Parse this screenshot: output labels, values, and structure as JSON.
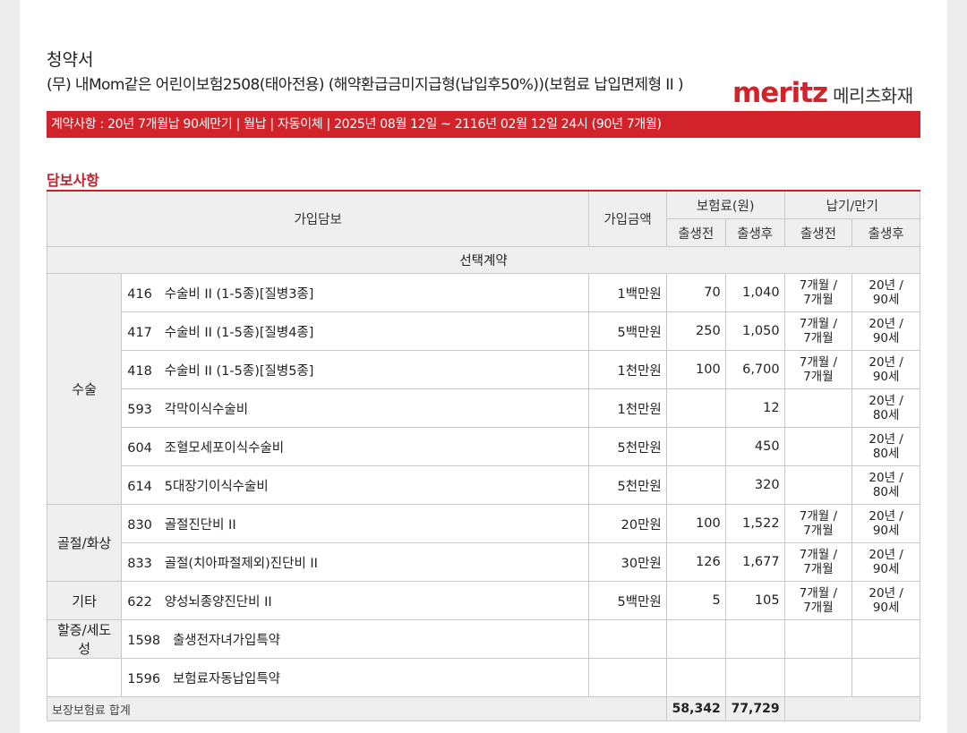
{
  "doc_title": "청약서",
  "product_name": "(무) 내Mom같은 어린이보험2508(태아전용) (해약환급금미지급형(납입후50%))(보험료 납입면제형 II )",
  "brand": {
    "logo_text": "meritz",
    "name_kr": "메리츠화재",
    "accent_color": "#d2232a"
  },
  "contract_info": "계약사항 : 20년 7개월납 90세만기 | 월납 | 자동이체 | 2025년 08월 12일 ~ 2116년 02월 12일 24시 (90년 7개월)",
  "section_title": "담보사항",
  "table": {
    "headers": {
      "coverage": "가입담보",
      "amount": "가입금액",
      "premium": "보험료(원)",
      "term": "납기/만기",
      "before_birth": "출생전",
      "after_birth": "출생후"
    },
    "optional_label": "선택계약",
    "categories": {
      "surgery": "수술",
      "fracture_burn": "골절/화상",
      "other": "기타",
      "discount": "할증/세도성"
    },
    "rows": [
      {
        "code": "416",
        "name": "수술비 II (1-5종)[질병3종]",
        "amount": "1백만원",
        "prem_before": "70",
        "prem_after": "1,040",
        "term_before_1": "7개월 /",
        "term_before_2": "7개월",
        "term_after_1": "20년 /",
        "term_after_2": "90세"
      },
      {
        "code": "417",
        "name": "수술비 II (1-5종)[질병4종]",
        "amount": "5백만원",
        "prem_before": "250",
        "prem_after": "1,050",
        "term_before_1": "7개월 /",
        "term_before_2": "7개월",
        "term_after_1": "20년 /",
        "term_after_2": "90세"
      },
      {
        "code": "418",
        "name": "수술비 II (1-5종)[질병5종]",
        "amount": "1천만원",
        "prem_before": "100",
        "prem_after": "6,700",
        "term_before_1": "7개월 /",
        "term_before_2": "7개월",
        "term_after_1": "20년 /",
        "term_after_2": "90세"
      },
      {
        "code": "593",
        "name": "각막이식수술비",
        "amount": "1천만원",
        "prem_before": "",
        "prem_after": "12",
        "term_before_1": "",
        "term_before_2": "",
        "term_after_1": "20년 /",
        "term_after_2": "80세"
      },
      {
        "code": "604",
        "name": "조혈모세포이식수술비",
        "amount": "5천만원",
        "prem_before": "",
        "prem_after": "450",
        "term_before_1": "",
        "term_before_2": "",
        "term_after_1": "20년 /",
        "term_after_2": "80세"
      },
      {
        "code": "614",
        "name": "5대장기이식수술비",
        "amount": "5천만원",
        "prem_before": "",
        "prem_after": "320",
        "term_before_1": "",
        "term_before_2": "",
        "term_after_1": "20년 /",
        "term_after_2": "80세"
      },
      {
        "code": "830",
        "name": "골절진단비 II",
        "amount": "20만원",
        "prem_before": "100",
        "prem_after": "1,522",
        "term_before_1": "7개월 /",
        "term_before_2": "7개월",
        "term_after_1": "20년 /",
        "term_after_2": "90세"
      },
      {
        "code": "833",
        "name": "골절(치아파절제외)진단비 II",
        "amount": "30만원",
        "prem_before": "126",
        "prem_after": "1,677",
        "term_before_1": "7개월 /",
        "term_before_2": "7개월",
        "term_after_1": "20년 /",
        "term_after_2": "90세"
      },
      {
        "code": "622",
        "name": "양성뇌종양진단비 II",
        "amount": "5백만원",
        "prem_before": "5",
        "prem_after": "105",
        "term_before_1": "7개월 /",
        "term_before_2": "7개월",
        "term_after_1": "20년 /",
        "term_after_2": "90세"
      },
      {
        "code": "1598",
        "name": "출생전자녀가입특약",
        "amount": "",
        "prem_before": "",
        "prem_after": "",
        "term_before_1": "",
        "term_before_2": "",
        "term_after_1": "",
        "term_after_2": ""
      },
      {
        "code": "1596",
        "name": "보험료자동납입특약",
        "amount": "",
        "prem_before": "",
        "prem_after": "",
        "term_before_1": "",
        "term_before_2": "",
        "term_after_1": "",
        "term_after_2": ""
      }
    ],
    "total": {
      "label": "보장보험료 합계",
      "before": "58,342",
      "after": "77,729"
    }
  }
}
